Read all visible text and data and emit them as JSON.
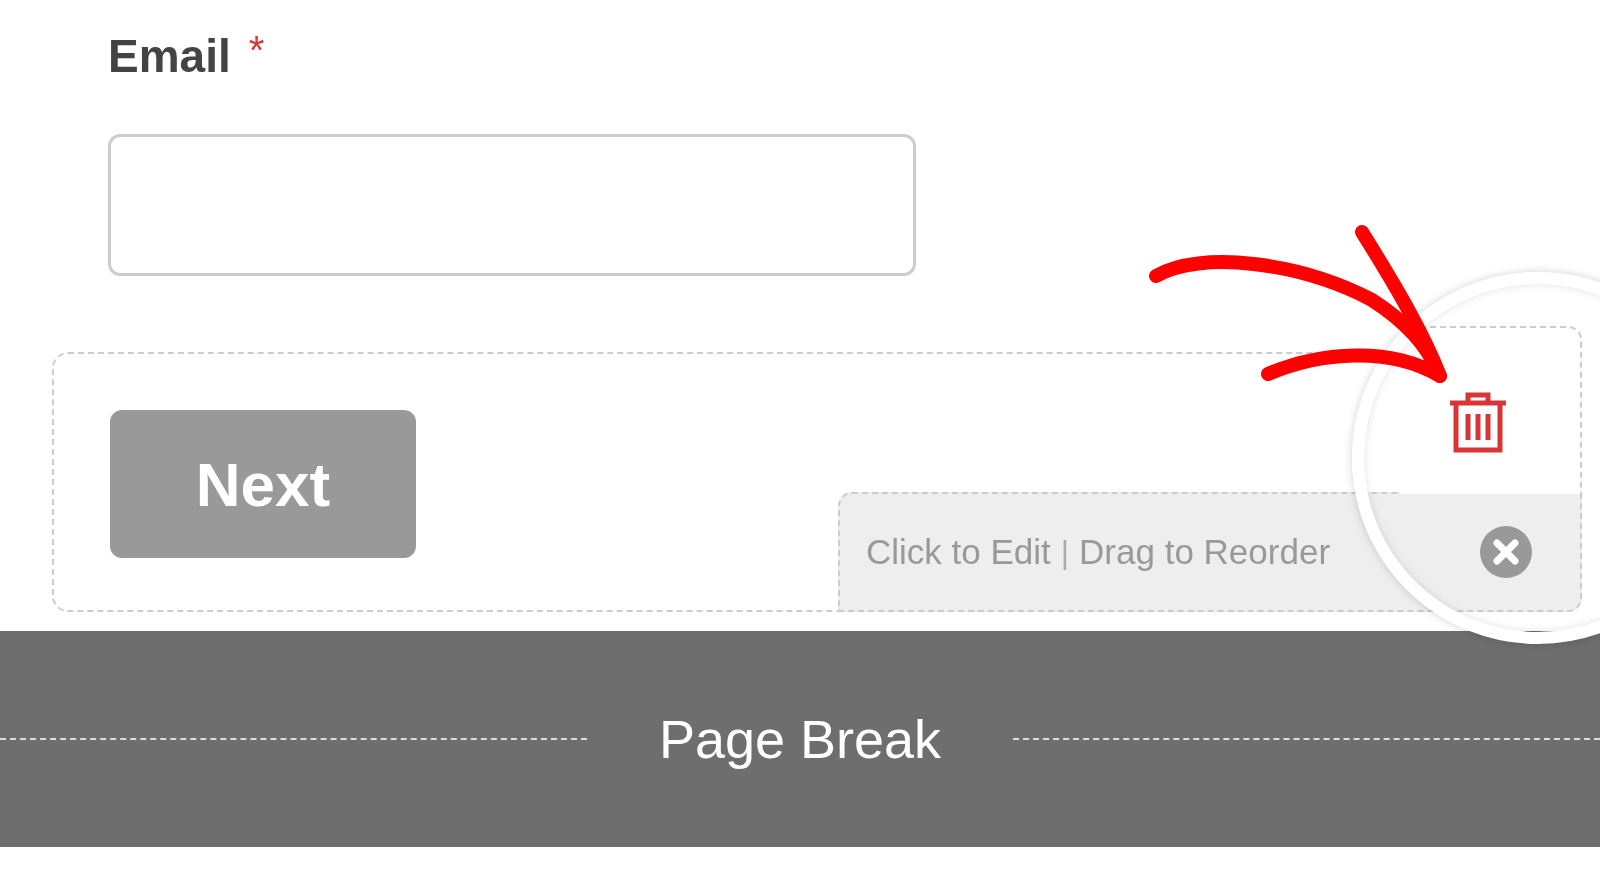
{
  "field": {
    "label": "Email",
    "required": true,
    "required_mark": "*"
  },
  "next_button": {
    "label": "Next"
  },
  "toolbar": {
    "edit_hint": "Click to Edit",
    "separator": "|",
    "reorder_hint": "Drag to Reorder"
  },
  "page_break": {
    "label": "Page Break"
  }
}
